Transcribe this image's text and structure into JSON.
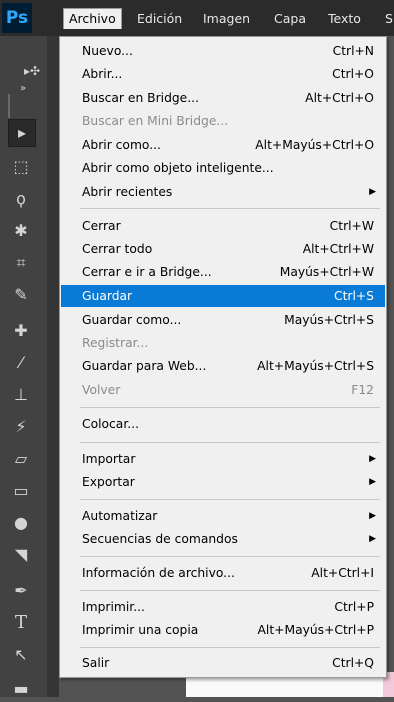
{
  "app_logo": "Ps",
  "menubar": {
    "items": [
      "Archivo",
      "Edición",
      "Imagen",
      "Capa",
      "Texto",
      "S"
    ],
    "active": "Archivo"
  },
  "colors": {
    "highlight": "#0a7ad7",
    "menu_bg": "#f0f0f0",
    "toolbar_bg": "#424242"
  },
  "file_menu": {
    "items": [
      {
        "label": "Nuevo...",
        "shortcut": "Ctrl+N"
      },
      {
        "label": "Abrir...",
        "shortcut": "Ctrl+O"
      },
      {
        "label": "Buscar en Bridge...",
        "shortcut": "Alt+Ctrl+O"
      },
      {
        "label": "Buscar en Mini Bridge...",
        "shortcut": "",
        "disabled": true
      },
      {
        "label": "Abrir como...",
        "shortcut": "Alt+Mayús+Ctrl+O"
      },
      {
        "label": "Abrir como objeto inteligente...",
        "shortcut": ""
      },
      {
        "label": "Abrir recientes",
        "shortcut": "",
        "submenu": true
      },
      {
        "label": "Cerrar",
        "shortcut": "Ctrl+W"
      },
      {
        "label": "Cerrar todo",
        "shortcut": "Alt+Ctrl+W"
      },
      {
        "label": "Cerrar e ir a Bridge...",
        "shortcut": "Mayús+Ctrl+W"
      },
      {
        "label": "Guardar",
        "shortcut": "Ctrl+S",
        "highlighted": true
      },
      {
        "label": "Guardar como...",
        "shortcut": "Mayús+Ctrl+S"
      },
      {
        "label": "Registrar...",
        "shortcut": "",
        "disabled": true
      },
      {
        "label": "Guardar para Web...",
        "shortcut": "Alt+Mayús+Ctrl+S"
      },
      {
        "label": "Volver",
        "shortcut": "F12",
        "disabled": true
      },
      {
        "label": "Colocar...",
        "shortcut": ""
      },
      {
        "label": "Importar",
        "shortcut": "",
        "submenu": true
      },
      {
        "label": "Exportar",
        "shortcut": "",
        "submenu": true
      },
      {
        "label": "Automatizar",
        "shortcut": "",
        "submenu": true
      },
      {
        "label": "Secuencias de comandos",
        "shortcut": "",
        "submenu": true
      },
      {
        "label": "Información de archivo...",
        "shortcut": "Alt+Ctrl+I"
      },
      {
        "label": "Imprimir...",
        "shortcut": "Ctrl+P"
      },
      {
        "label": "Imprimir una copia",
        "shortcut": "Alt+Mayús+Ctrl+P"
      },
      {
        "label": "Salir",
        "shortcut": "Ctrl+Q"
      }
    ],
    "submenu_arrow": "▶"
  },
  "toolbar": {
    "tools": [
      {
        "icon": "move-icon",
        "glyph": "▸",
        "selected": true
      },
      {
        "icon": "marquee-icon",
        "glyph": "⬚"
      },
      {
        "icon": "lasso-icon",
        "glyph": "ϙ"
      },
      {
        "icon": "magic-wand-icon",
        "glyph": "✱"
      },
      {
        "icon": "crop-icon",
        "glyph": "⌗"
      },
      {
        "icon": "eyedropper-icon",
        "glyph": "✎"
      },
      {
        "icon": "healing-brush-icon",
        "glyph": "✚"
      },
      {
        "icon": "brush-icon",
        "glyph": "⁄"
      },
      {
        "icon": "clone-stamp-icon",
        "glyph": "⊥"
      },
      {
        "icon": "history-brush-icon",
        "glyph": "⚡"
      },
      {
        "icon": "eraser-icon",
        "glyph": "▱"
      },
      {
        "icon": "gradient-icon",
        "glyph": "▭"
      },
      {
        "icon": "blur-icon",
        "glyph": "●"
      },
      {
        "icon": "dodge-icon",
        "glyph": "◥"
      },
      {
        "icon": "pen-icon",
        "glyph": "✒"
      },
      {
        "icon": "type-icon",
        "glyph": "T"
      },
      {
        "icon": "path-selection-icon",
        "glyph": "↖"
      },
      {
        "icon": "rectangle-icon",
        "glyph": "▬"
      }
    ],
    "top_controls": [
      {
        "icon": "move-options-icon",
        "glyph": "▸✣"
      },
      {
        "icon": "expand-panel-icon",
        "glyph": "»"
      }
    ]
  }
}
